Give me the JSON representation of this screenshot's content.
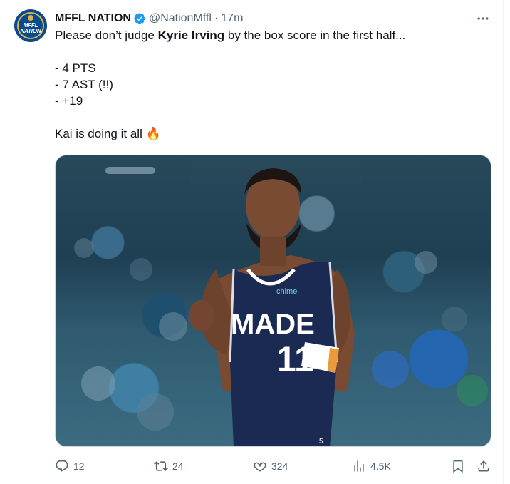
{
  "tweet": {
    "author_name": "MFFL NATION",
    "handle": "@NationMffl",
    "separator": "·",
    "time": "17m",
    "avatar_text_1": "MFFL",
    "avatar_text_2": "NATION",
    "body_prefix": "Please don’t judge ",
    "body_bold": "Kyrie Irving",
    "body_suffix": " by the box score in the first half...",
    "stat_1": "- 4 PTS",
    "stat_2": "- 7 AST (!!)",
    "stat_3": "- +19",
    "closing": "Kai is doing it all",
    "closing_emoji": "🔥",
    "jersey_team": "MADE",
    "jersey_number": "11",
    "jersey_sponsor": "chime",
    "jersey_small_number": "5"
  },
  "actions": {
    "replies": "12",
    "retweets": "24",
    "likes": "324",
    "views": "4.5K"
  },
  "colors": {
    "brand_blue": "#1d9bf0",
    "text_secondary": "#536471",
    "jersey_navy": "#1b2a52"
  },
  "icons": [
    "verified-icon",
    "more-icon",
    "reply-icon",
    "retweet-icon",
    "like-icon",
    "views-icon",
    "bookmark-icon",
    "share-icon"
  ]
}
